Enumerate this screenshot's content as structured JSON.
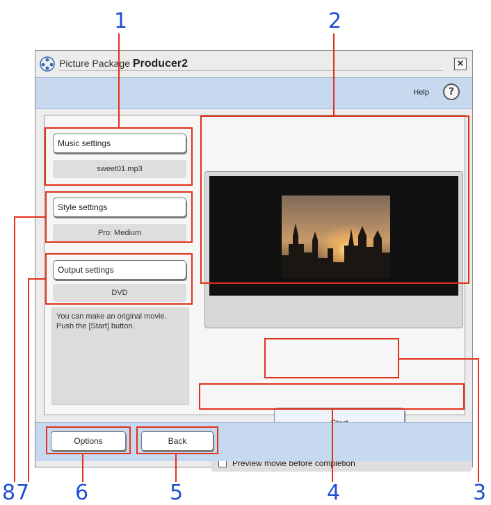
{
  "callouts": [
    "1",
    "2",
    "3",
    "4",
    "5",
    "6",
    "7",
    "8"
  ],
  "window": {
    "title_prefix": "Picture Package",
    "title_bold": "Producer2",
    "close_glyph": "×",
    "help_label": "Help",
    "help_glyph": "?"
  },
  "settings": {
    "music": {
      "label": "Music settings",
      "value": "sweet01.mp3"
    },
    "style": {
      "label": "Style settings",
      "value": "Pro: Medium"
    },
    "output": {
      "label": "Output settings",
      "value": "DVD"
    }
  },
  "description": "You can make an original movie. Push the [Start] button.",
  "start_label": "Start",
  "preview_checkbox": {
    "label": "Preview movie before completion",
    "checked": false
  },
  "bottom": {
    "options_label": "Options",
    "back_label": "Back"
  },
  "colors": {
    "callout_number": "#1f4fd0",
    "callout_line": "#e1311a",
    "bar_blue": "#c6d9ef"
  }
}
